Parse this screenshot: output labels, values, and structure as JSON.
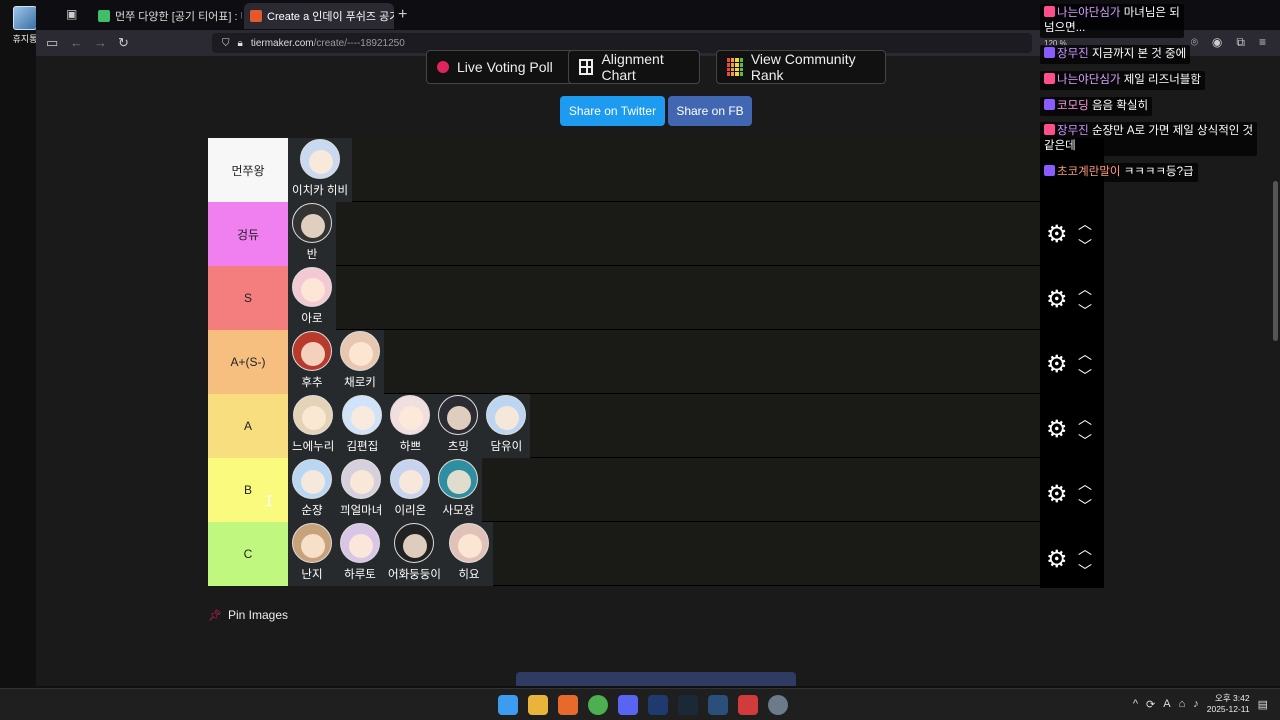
{
  "desktop": {
    "recycle_bin_label": "휴지통"
  },
  "tabs": [
    {
      "title": "먼쭈 다양한 [공기 티어표] : 네",
      "favicon_color": "#3fbf6a"
    },
    {
      "title": "Create a 인데이 푸쉬즈 공기 E",
      "favicon_color": "#e05a2b"
    }
  ],
  "url": {
    "domain": "tiermaker.com",
    "path": "/create/----18921250",
    "zoom": "120 %"
  },
  "buttons": {
    "live_voting": "Live Voting Poll",
    "alignment": "Alignment Chart",
    "community_rank": "View Community Rank",
    "share_twitter": "Share on Twitter",
    "share_fb": "Share on FB",
    "twitter_color": "#1d9bf0",
    "fb_color": "#4267b2"
  },
  "tiers": [
    {
      "label": "먼쭈왕",
      "color": "#f7f7f7",
      "items": [
        {
          "name": "이치카 히비",
          "avatar_color": "#c9d9f0"
        }
      ]
    },
    {
      "label": "겅듀",
      "color": "#f07ff0",
      "items": [
        {
          "name": "반",
          "avatar_color": "#333333"
        }
      ]
    },
    {
      "label": "S",
      "color": "#f47e7e",
      "items": [
        {
          "name": "아로",
          "avatar_color": "#f3c9d3"
        }
      ]
    },
    {
      "label": "A+(S-)",
      "color": "#f7bf7f",
      "items": [
        {
          "name": "후추",
          "avatar_color": "#b83a2c"
        },
        {
          "name": "채로키",
          "avatar_color": "#e8c7b0"
        }
      ]
    },
    {
      "label": "A",
      "color": "#f8de7f",
      "items": [
        {
          "name": "느에누리",
          "avatar_color": "#e5d3b8"
        },
        {
          "name": "김편집",
          "avatar_color": "#cfe3fa"
        },
        {
          "name": "하쁘",
          "avatar_color": "#f1dfe0"
        },
        {
          "name": "츠밍",
          "avatar_color": "#2b2b33"
        },
        {
          "name": "담유이",
          "avatar_color": "#bcd5f0"
        }
      ]
    },
    {
      "label": "B",
      "color": "#fafa7f",
      "items": [
        {
          "name": "순쟝",
          "avatar_color": "#b9d7f3"
        },
        {
          "name": "끠얼마녀",
          "avatar_color": "#d5d0dc"
        },
        {
          "name": "이리온",
          "avatar_color": "#c6d4f0"
        },
        {
          "name": "사모장",
          "avatar_color": "#2f8fa0"
        }
      ]
    },
    {
      "label": "C",
      "color": "#bff77f",
      "items": [
        {
          "name": "난지",
          "avatar_color": "#c8a27a"
        },
        {
          "name": "하루토",
          "avatar_color": "#d9c6e6"
        },
        {
          "name": "어화둥둥이",
          "avatar_color": "#222222"
        },
        {
          "name": "히요",
          "avatar_color": "#e0c2b8"
        }
      ]
    }
  ],
  "pin_images_label": "Pin Images",
  "chat": [
    {
      "nick": "나는야단심가",
      "nick_color": "#d9a6ff",
      "text": "마녀님은 되\n넘으면..."
    },
    {
      "nick": "장무진",
      "nick_color": "#c79bff",
      "text": "지금까지 본 것 중에"
    },
    {
      "nick": "나는야단심가",
      "nick_color": "#d9a6ff",
      "text": "제일 리즈너블함"
    },
    {
      "nick": "코모딩",
      "nick_color": "#ff9ee0",
      "text": "음음 확실히"
    },
    {
      "nick": "장무진",
      "nick_color": "#c79bff",
      "text": "순쟝만 A로 가면 제일 상식적인 것\n같은데"
    },
    {
      "nick": "초코계란말이",
      "nick_color": "#ff9a7a",
      "text": "ㅋㅋㅋㅋ등?급"
    }
  ],
  "clock": {
    "time": "오후 3:42",
    "date": "2025-12-11"
  }
}
